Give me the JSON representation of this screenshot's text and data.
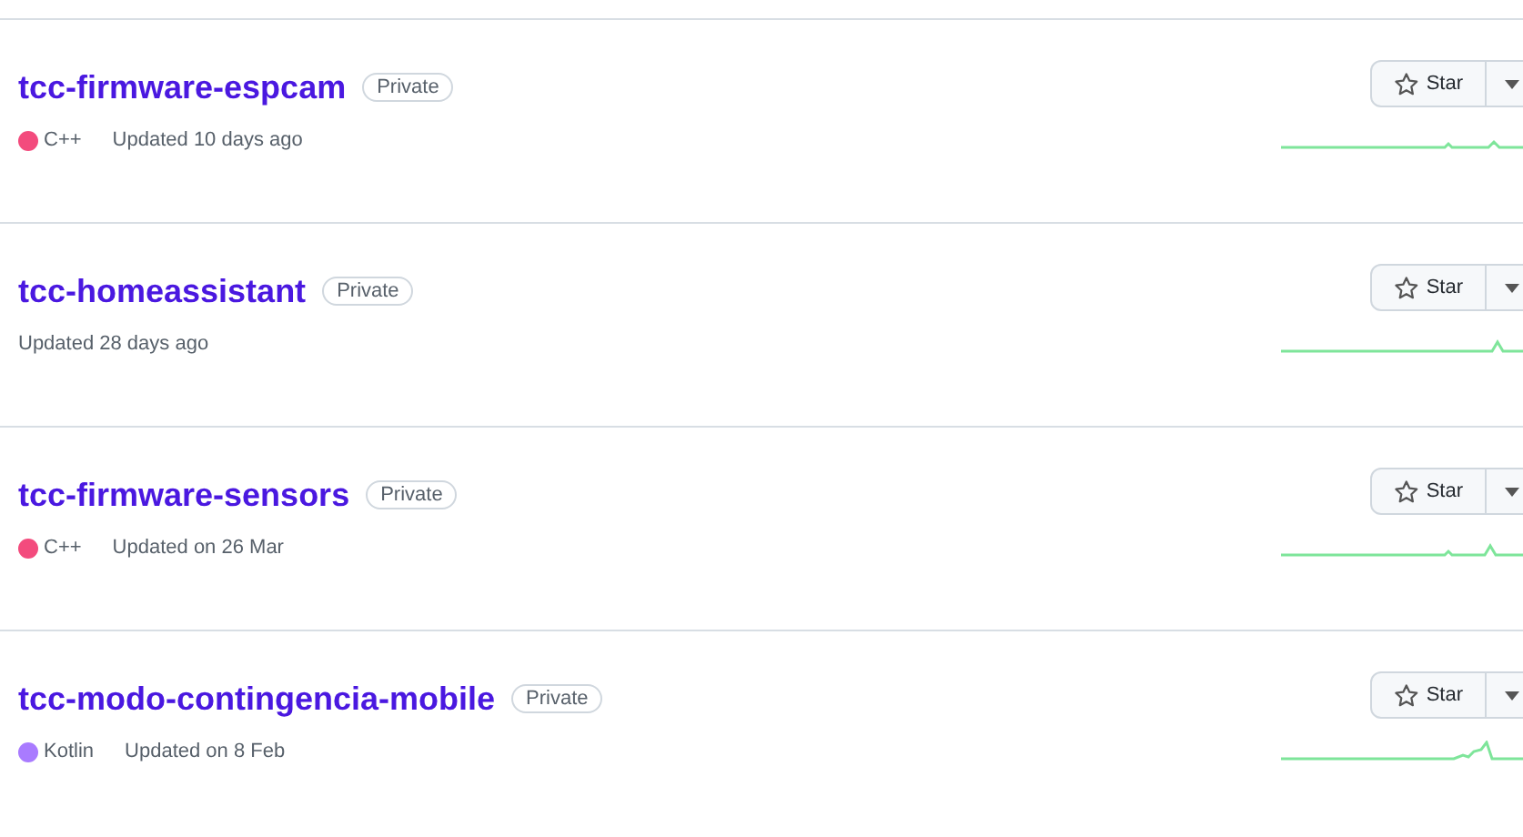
{
  "repositories": [
    {
      "name": "tcc-firmware-espcam",
      "visibility": "Private",
      "language": {
        "name": "C++",
        "color": "#f34b7d"
      },
      "updated": "Updated 10 days ago",
      "star_label": "Star"
    },
    {
      "name": "tcc-homeassistant",
      "visibility": "Private",
      "updated": "Updated 28 days ago",
      "star_label": "Star"
    },
    {
      "name": "tcc-firmware-sensors",
      "visibility": "Private",
      "language": {
        "name": "C++",
        "color": "#f34b7d"
      },
      "updated": "Updated on 26 Mar",
      "star_label": "Star"
    },
    {
      "name": "tcc-modo-contingencia-mobile",
      "visibility": "Private",
      "language": {
        "name": "Kotlin",
        "color": "#a97bff"
      },
      "updated": "Updated on 8 Feb",
      "star_label": "Star"
    }
  ]
}
